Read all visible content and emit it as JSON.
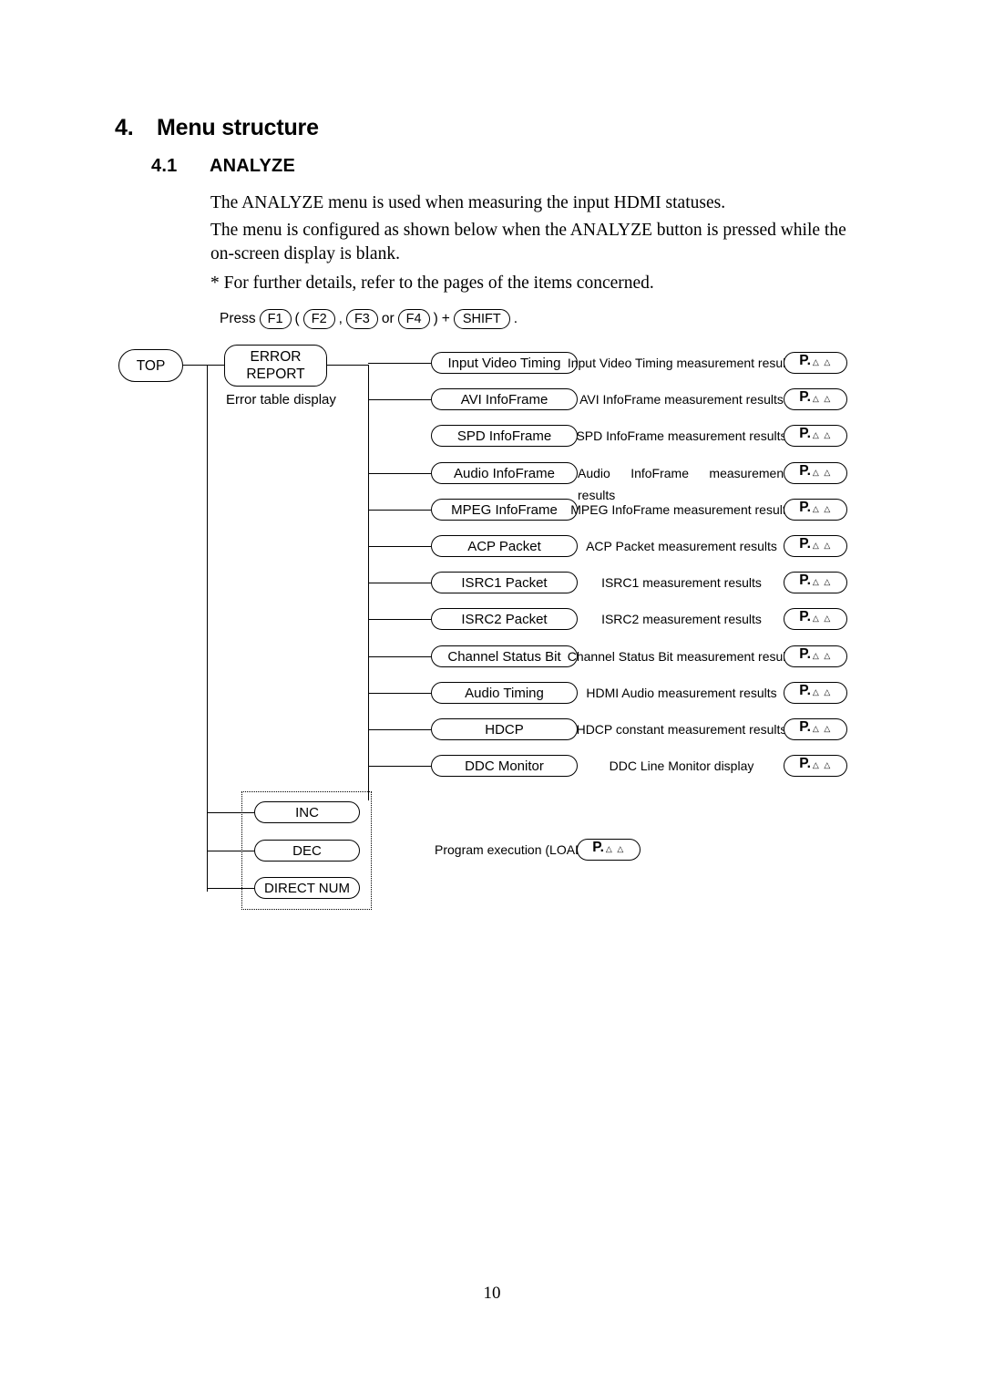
{
  "document": {
    "chapter_number": "4.",
    "chapter_title": "Menu structure",
    "section_number": "4.1",
    "section_title": "ANALYZE",
    "paragraph_1": "The ANALYZE menu is used when measuring the input HDMI statuses.",
    "paragraph_2": "The menu is configured as shown below when the ANALYZE button is pressed while the on-screen display is blank.",
    "paragraph_3": "* For further details, refer to the pages of the items concerned.",
    "page_number": "10"
  },
  "press_line": {
    "prefix": "Press",
    "key_f1": "F1",
    "paren_open": "(",
    "key_f2": "F2",
    "comma": ",",
    "key_f3": "F3",
    "or": "or",
    "key_f4": "F4",
    "paren_close": ")",
    "plus": "+",
    "key_shift": "SHIFT",
    "period": "."
  },
  "diagram": {
    "root": {
      "label": "TOP"
    },
    "branch": {
      "label_line1": "ERROR",
      "label_line2": "REPORT",
      "caption": "Error table display"
    },
    "page_ref": {
      "prefix": "P.",
      "triangles": "△ △"
    },
    "items": [
      {
        "label": "Input Video Timing",
        "description": "Input Video Timing measurement results",
        "connected": true,
        "justified": false
      },
      {
        "label": "AVI InfoFrame",
        "description": "AVI InfoFrame measurement results",
        "connected": true,
        "justified": false
      },
      {
        "label": "SPD InfoFrame",
        "description": "SPD InfoFrame measurement results",
        "connected": false,
        "justified": false
      },
      {
        "label": "Audio InfoFrame",
        "description": "Audio InfoFrame measurement results",
        "connected": true,
        "justified": true
      },
      {
        "label": "MPEG InfoFrame",
        "description": "MPEG InfoFrame measurement results",
        "connected": true,
        "justified": false
      },
      {
        "label": "ACP Packet",
        "description": "ACP Packet measurement results",
        "connected": true,
        "justified": false
      },
      {
        "label": "ISRC1 Packet",
        "description": "ISRC1 measurement results",
        "connected": true,
        "justified": false
      },
      {
        "label": "ISRC2 Packet",
        "description": "ISRC2 measurement results",
        "connected": true,
        "justified": false
      },
      {
        "label": "Channel Status Bit",
        "description": "Channel Status Bit measurement results",
        "connected": true,
        "justified": false
      },
      {
        "label": "Audio Timing",
        "description": "HDMI Audio measurement results",
        "connected": true,
        "justified": false
      },
      {
        "label": "HDCP",
        "description": "HDCP constant measurement results",
        "connected": true,
        "justified": false
      },
      {
        "label": "DDC Monitor",
        "description": "DDC Line Monitor display",
        "connected": true,
        "justified": false
      }
    ],
    "grouped_items": [
      {
        "label": "INC"
      },
      {
        "label": "DEC"
      },
      {
        "label": "DIRECT NUM"
      }
    ],
    "program": {
      "label": "Program execution (LOAD)",
      "page_prefix": "P.",
      "page_triangles": "△ △"
    }
  }
}
